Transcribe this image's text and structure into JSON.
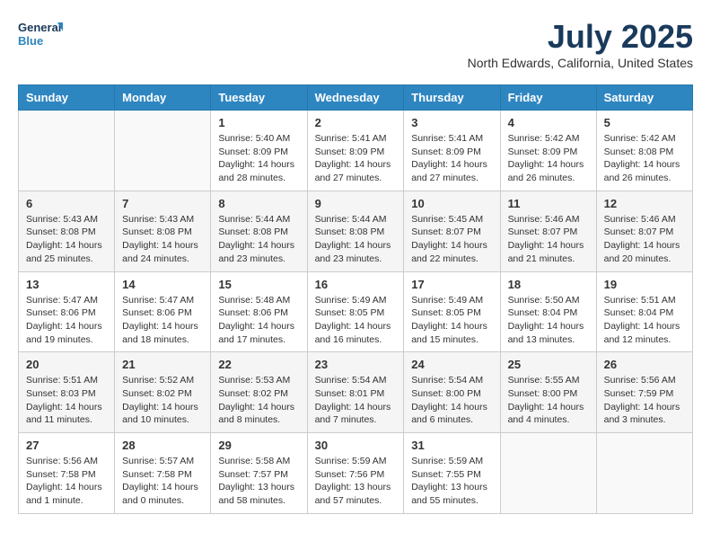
{
  "logo": {
    "line1": "General",
    "line2": "Blue"
  },
  "title": "July 2025",
  "location": "North Edwards, California, United States",
  "weekdays": [
    "Sunday",
    "Monday",
    "Tuesday",
    "Wednesday",
    "Thursday",
    "Friday",
    "Saturday"
  ],
  "weeks": [
    [
      {
        "day": "",
        "info": ""
      },
      {
        "day": "",
        "info": ""
      },
      {
        "day": "1",
        "info": "Sunrise: 5:40 AM\nSunset: 8:09 PM\nDaylight: 14 hours and 28 minutes."
      },
      {
        "day": "2",
        "info": "Sunrise: 5:41 AM\nSunset: 8:09 PM\nDaylight: 14 hours and 27 minutes."
      },
      {
        "day": "3",
        "info": "Sunrise: 5:41 AM\nSunset: 8:09 PM\nDaylight: 14 hours and 27 minutes."
      },
      {
        "day": "4",
        "info": "Sunrise: 5:42 AM\nSunset: 8:09 PM\nDaylight: 14 hours and 26 minutes."
      },
      {
        "day": "5",
        "info": "Sunrise: 5:42 AM\nSunset: 8:08 PM\nDaylight: 14 hours and 26 minutes."
      }
    ],
    [
      {
        "day": "6",
        "info": "Sunrise: 5:43 AM\nSunset: 8:08 PM\nDaylight: 14 hours and 25 minutes."
      },
      {
        "day": "7",
        "info": "Sunrise: 5:43 AM\nSunset: 8:08 PM\nDaylight: 14 hours and 24 minutes."
      },
      {
        "day": "8",
        "info": "Sunrise: 5:44 AM\nSunset: 8:08 PM\nDaylight: 14 hours and 23 minutes."
      },
      {
        "day": "9",
        "info": "Sunrise: 5:44 AM\nSunset: 8:08 PM\nDaylight: 14 hours and 23 minutes."
      },
      {
        "day": "10",
        "info": "Sunrise: 5:45 AM\nSunset: 8:07 PM\nDaylight: 14 hours and 22 minutes."
      },
      {
        "day": "11",
        "info": "Sunrise: 5:46 AM\nSunset: 8:07 PM\nDaylight: 14 hours and 21 minutes."
      },
      {
        "day": "12",
        "info": "Sunrise: 5:46 AM\nSunset: 8:07 PM\nDaylight: 14 hours and 20 minutes."
      }
    ],
    [
      {
        "day": "13",
        "info": "Sunrise: 5:47 AM\nSunset: 8:06 PM\nDaylight: 14 hours and 19 minutes."
      },
      {
        "day": "14",
        "info": "Sunrise: 5:47 AM\nSunset: 8:06 PM\nDaylight: 14 hours and 18 minutes."
      },
      {
        "day": "15",
        "info": "Sunrise: 5:48 AM\nSunset: 8:06 PM\nDaylight: 14 hours and 17 minutes."
      },
      {
        "day": "16",
        "info": "Sunrise: 5:49 AM\nSunset: 8:05 PM\nDaylight: 14 hours and 16 minutes."
      },
      {
        "day": "17",
        "info": "Sunrise: 5:49 AM\nSunset: 8:05 PM\nDaylight: 14 hours and 15 minutes."
      },
      {
        "day": "18",
        "info": "Sunrise: 5:50 AM\nSunset: 8:04 PM\nDaylight: 14 hours and 13 minutes."
      },
      {
        "day": "19",
        "info": "Sunrise: 5:51 AM\nSunset: 8:04 PM\nDaylight: 14 hours and 12 minutes."
      }
    ],
    [
      {
        "day": "20",
        "info": "Sunrise: 5:51 AM\nSunset: 8:03 PM\nDaylight: 14 hours and 11 minutes."
      },
      {
        "day": "21",
        "info": "Sunrise: 5:52 AM\nSunset: 8:02 PM\nDaylight: 14 hours and 10 minutes."
      },
      {
        "day": "22",
        "info": "Sunrise: 5:53 AM\nSunset: 8:02 PM\nDaylight: 14 hours and 8 minutes."
      },
      {
        "day": "23",
        "info": "Sunrise: 5:54 AM\nSunset: 8:01 PM\nDaylight: 14 hours and 7 minutes."
      },
      {
        "day": "24",
        "info": "Sunrise: 5:54 AM\nSunset: 8:00 PM\nDaylight: 14 hours and 6 minutes."
      },
      {
        "day": "25",
        "info": "Sunrise: 5:55 AM\nSunset: 8:00 PM\nDaylight: 14 hours and 4 minutes."
      },
      {
        "day": "26",
        "info": "Sunrise: 5:56 AM\nSunset: 7:59 PM\nDaylight: 14 hours and 3 minutes."
      }
    ],
    [
      {
        "day": "27",
        "info": "Sunrise: 5:56 AM\nSunset: 7:58 PM\nDaylight: 14 hours and 1 minute."
      },
      {
        "day": "28",
        "info": "Sunrise: 5:57 AM\nSunset: 7:58 PM\nDaylight: 14 hours and 0 minutes."
      },
      {
        "day": "29",
        "info": "Sunrise: 5:58 AM\nSunset: 7:57 PM\nDaylight: 13 hours and 58 minutes."
      },
      {
        "day": "30",
        "info": "Sunrise: 5:59 AM\nSunset: 7:56 PM\nDaylight: 13 hours and 57 minutes."
      },
      {
        "day": "31",
        "info": "Sunrise: 5:59 AM\nSunset: 7:55 PM\nDaylight: 13 hours and 55 minutes."
      },
      {
        "day": "",
        "info": ""
      },
      {
        "day": "",
        "info": ""
      }
    ]
  ]
}
